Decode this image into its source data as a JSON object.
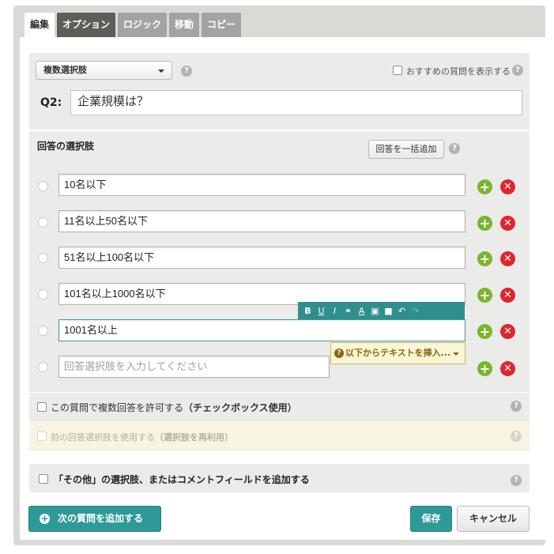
{
  "tabs": [
    {
      "label": "編集"
    },
    {
      "label": "オプション"
    },
    {
      "label": "ロジック"
    },
    {
      "label": "移動"
    },
    {
      "label": "コピー"
    }
  ],
  "question": {
    "type_select": "複数選択肢",
    "show_recommended_label": "おすすめの質問を表示する",
    "number_label": "Q2:",
    "text": "企業規模は？"
  },
  "answers": {
    "title": "回答の選択肢",
    "bulk_add_label": "回答を一括追加",
    "items": [
      {
        "value": "10名以下"
      },
      {
        "value": "11名以上50名以下"
      },
      {
        "value": "51名以上100名以下"
      },
      {
        "value": "101名以上1000名以下"
      },
      {
        "value": "1001名以上"
      }
    ],
    "new_placeholder": "回答選択肢を入力してください",
    "insert_text_label": "以下からテキストを挿入..."
  },
  "rte_toolbar": [
    "B",
    "U",
    "I",
    "link",
    "A",
    "image",
    "video",
    "undo",
    "redo"
  ],
  "options": {
    "multi_answer_label": "この質問で複数回答を許可する",
    "multi_answer_hint": "（チェックボックス使用）",
    "reuse_label": "前の回答選択肢を使用する",
    "reuse_hint": "（選択肢を再利用）",
    "other_label": "「その他」の選択肢、またはコメントフィールドを追加する"
  },
  "footer": {
    "next_label": "次の質問を追加する",
    "save_label": "保存",
    "cancel_label": "キャンセル"
  },
  "colors": {
    "accent": "#2e9a98",
    "add": "#7ab52c",
    "delete": "#e0252d"
  }
}
